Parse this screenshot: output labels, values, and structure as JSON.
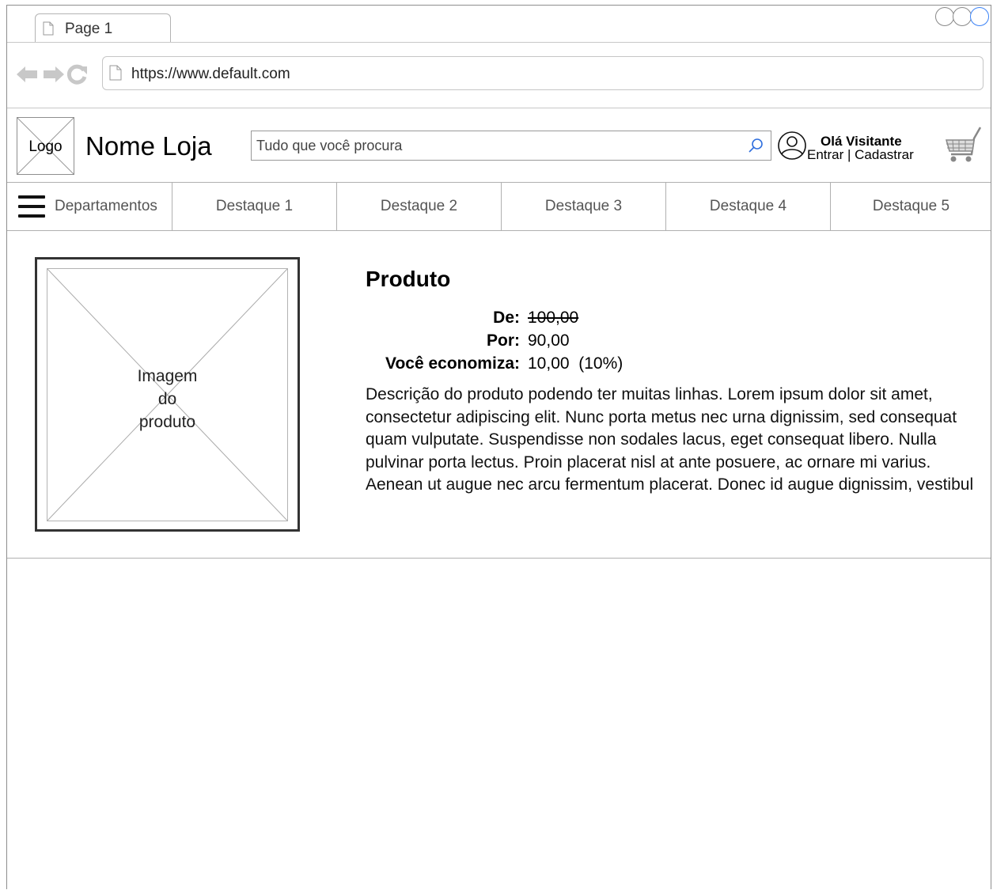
{
  "browser": {
    "tab_label": "Page 1",
    "url": "https://www.default.com"
  },
  "store": {
    "logo_label": "Logo",
    "name": "Nome Loja",
    "search_placeholder": "Tudo que você procura",
    "greeting": "Olá Visitante",
    "auth_links": "Entrar | Cadastrar"
  },
  "nav": {
    "departments_label": "Departamentos",
    "items": [
      "Destaque 1",
      "Destaque 2",
      "Destaque 3",
      "Destaque 4",
      "Destaque 5"
    ]
  },
  "product": {
    "image_label_lines": [
      "Imagem",
      "do",
      "produto"
    ],
    "title": "Produto",
    "price_rows": [
      {
        "label": "De:",
        "value": "100,00"
      },
      {
        "label": "Por:",
        "value": "90,00"
      },
      {
        "label": "Você economiza:",
        "value": "10,00  (10%)"
      }
    ],
    "description": "Descrição do produto podendo ter muitas linhas. Lorem ipsum dolor sit amet, consectetur adipiscing elit. Nunc porta metus nec urna dignissim, sed consequat quam vulputate. Suspendisse non sodales lacus, eget consequat libero. Nulla pulvinar porta lectus. Proin placerat nisl at ante posuere, ac ornare mi varius. Aenean ut augue nec arcu fermentum placerat. Donec id augue dignissim, vestibul"
  },
  "icons": {
    "tab": "page-icon",
    "nav_back": "arrow-left-icon",
    "nav_forward": "arrow-right-icon",
    "reload": "reload-icon",
    "url": "page-icon",
    "search": "search-icon",
    "user": "user-icon",
    "cart": "cart-icon",
    "menu": "hamburger-icon"
  },
  "colors": {
    "accent": "#3b82f6",
    "border": "#8e8e8e"
  }
}
